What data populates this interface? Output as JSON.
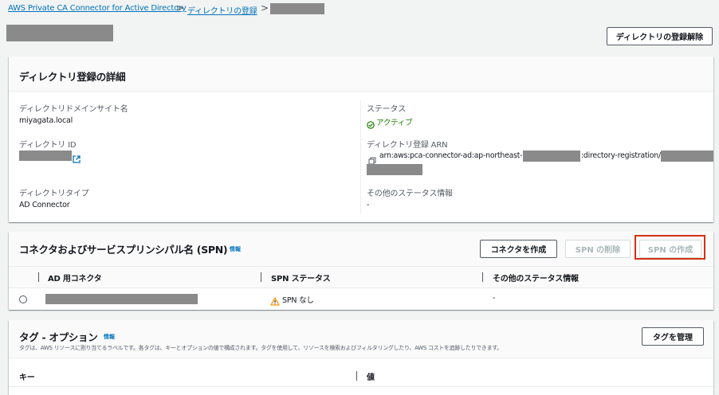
{
  "breadcrumb": {
    "items": [
      "AWS Private CA Connector for Active Directory",
      "ディレクトリの登録"
    ],
    "separator": ">"
  },
  "header": {
    "deregister_button": "ディレクトリの登録解除"
  },
  "details": {
    "title": "ディレクトリ登録の詳細",
    "domain_label": "ディレクトリドメインサイト名",
    "domain_value": "miyagata.local",
    "directory_id_label": "ディレクトリ ID",
    "directory_type_label": "ディレクトリタイプ",
    "directory_type_value": "AD Connector",
    "status_label": "ステータス",
    "status_value": "アクティブ",
    "arn_label": "ディレクトリ登録 ARN",
    "arn_prefix": "arn:aws:pca-connector-ad:ap-northeast-1",
    "arn_middle": ":directory-registration/",
    "other_status_label": "その他のステータス情報",
    "other_status_value": "-"
  },
  "connectors": {
    "title": "コネクタおよびサービスプリンシパル名 (SPN)",
    "info": "情報",
    "buttons": {
      "create_connector": "コネクタを作成",
      "delete_spn": "SPN の削除",
      "create_spn": "SPN の作成"
    },
    "columns": [
      "AD 用コネクタ",
      "SPN ステータス",
      "その他のステータス情報"
    ],
    "rows": [
      {
        "spn_status": "SPN なし",
        "other": "-"
      }
    ]
  },
  "tags": {
    "title": "タグ - オプション",
    "info": "情報",
    "description": "タグは、AWS リソースに割り当てるラベルです。各タグは、キーとオプションの値で構成されます。タグを使用して、リソースを検索およびフィルタリングしたり、AWS コストを追跡したりできます。",
    "manage_button": "タグを管理",
    "columns": [
      "キー",
      "値"
    ]
  },
  "colors": {
    "link": "#0073bb",
    "success": "#1d8102",
    "warning": "#ff9900",
    "highlight": "#d13212"
  }
}
